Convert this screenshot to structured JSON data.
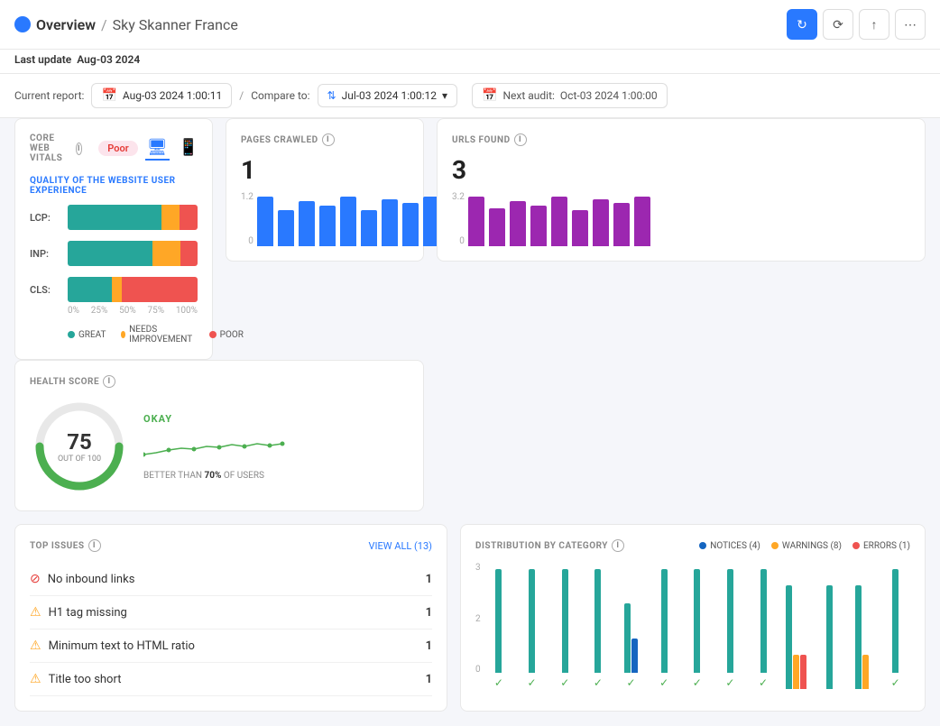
{
  "header": {
    "breadcrumb_overview": "Overview",
    "breadcrumb_sep": "/",
    "breadcrumb_page": "Sky Skanner France",
    "last_update_label": "Last update",
    "last_update_date": "Aug-03 2024"
  },
  "report_bar": {
    "current_label": "Current report:",
    "current_date": "Aug-03 2024 1:00:11",
    "sep": "/",
    "compare_label": "Compare to:",
    "compare_date": "Jul-03 2024 1:00:12",
    "next_audit_label": "Next audit:",
    "next_audit_date": "Oct-03 2024 1:00:00"
  },
  "pages_crawled": {
    "title": "PAGES CRAWLED",
    "value": "1",
    "scale_top": "1.2",
    "scale_bottom": "0",
    "bars": [
      55,
      40,
      50,
      45,
      55,
      40,
      52,
      48,
      55
    ]
  },
  "urls_found": {
    "title": "URLS FOUND",
    "value": "3",
    "scale_top": "3.2",
    "scale_bottom": "0",
    "bars": [
      55,
      42,
      50,
      45,
      55,
      40,
      52,
      48,
      55
    ]
  },
  "health_score": {
    "title": "HEALTH SCORE",
    "value": "75",
    "out_of": "OUT OF 100",
    "label": "OKAY",
    "footer_prefix": "BETTER THAN",
    "footer_pct": "70%",
    "footer_suffix": "OF USERS"
  },
  "core_web_vitals": {
    "title": "CORE WEB VITALS",
    "badge": "Poor",
    "subtitle": "QUALITY OF THE WEBSITE USER EXPERIENCE",
    "metrics": [
      {
        "name": "LCP:",
        "green": 72,
        "orange": 14,
        "red": 14
      },
      {
        "name": "INP:",
        "green": 65,
        "orange": 22,
        "red": 13
      },
      {
        "name": "CLS:",
        "green": 34,
        "orange": 8,
        "red": 58
      }
    ],
    "axis": [
      "0%",
      "25%",
      "50%",
      "75%",
      "100%"
    ],
    "legend": [
      {
        "label": "GREAT",
        "color": "#26a69a"
      },
      {
        "label": "NEEDS IMPROVEMENT",
        "color": "#ffa726"
      },
      {
        "label": "POOR",
        "color": "#ef5350"
      }
    ]
  },
  "top_issues": {
    "title": "TOP ISSUES",
    "view_all_label": "VIEW ALL (13)",
    "issues": [
      {
        "type": "error",
        "text": "No inbound links",
        "count": 1
      },
      {
        "type": "warning",
        "text": "H1 tag missing",
        "count": 1
      },
      {
        "type": "warning",
        "text": "Minimum text to HTML ratio",
        "count": 1
      },
      {
        "type": "warning",
        "text": "Title too short",
        "count": 1
      }
    ]
  },
  "distribution": {
    "title": "DISTRIBUTION BY CATEGORY",
    "legend": [
      {
        "label": "NOTICES (4)",
        "color": "#1565c0"
      },
      {
        "label": "WARNINGS (8)",
        "color": "#ffa726"
      },
      {
        "label": "ERRORS (1)",
        "color": "#ef5350"
      }
    ],
    "y_axis": [
      "3",
      "2",
      "0"
    ],
    "bars": [
      {
        "teal": 3,
        "blue": 0,
        "orange": 0,
        "red": 0,
        "check": true
      },
      {
        "teal": 3,
        "blue": 0,
        "orange": 0,
        "red": 0,
        "check": true
      },
      {
        "teal": 3,
        "blue": 0,
        "orange": 0,
        "red": 0,
        "check": true
      },
      {
        "teal": 3,
        "blue": 0,
        "orange": 0,
        "red": 0,
        "check": true
      },
      {
        "teal": 2,
        "blue": 1,
        "orange": 0,
        "red": 0,
        "check": true
      },
      {
        "teal": 3,
        "blue": 0,
        "orange": 0,
        "red": 0,
        "check": true
      },
      {
        "teal": 3,
        "blue": 0,
        "orange": 0,
        "red": 0,
        "check": true
      },
      {
        "teal": 3,
        "blue": 0,
        "orange": 0,
        "red": 0,
        "check": true
      },
      {
        "teal": 3,
        "blue": 0,
        "orange": 0,
        "red": 0,
        "check": true
      },
      {
        "teal": 3,
        "blue": 0,
        "orange": 1,
        "red": 1,
        "check": false
      },
      {
        "teal": 3,
        "blue": 0,
        "orange": 0,
        "red": 0,
        "check": false
      },
      {
        "teal": 3,
        "blue": 0,
        "orange": 1,
        "red": 0,
        "check": false
      },
      {
        "teal": 3,
        "blue": 0,
        "orange": 0,
        "red": 0,
        "check": true
      }
    ]
  }
}
